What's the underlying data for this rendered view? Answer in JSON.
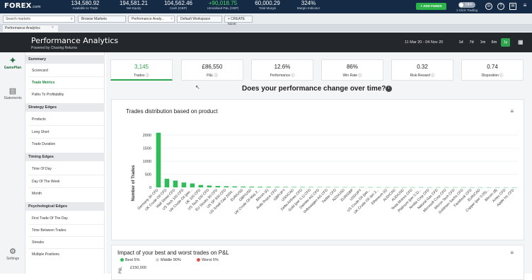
{
  "topbar": {
    "logo": "FOREX",
    "logo_suffix": ".com",
    "metrics": [
      {
        "value": "134,580.92",
        "label": "Available to Trade"
      },
      {
        "value": "194,581.21",
        "label": "Net Equity"
      },
      {
        "value": "104,562.46",
        "label": "Cash (GBP)"
      },
      {
        "value": "+90,018.75",
        "label": "Unrealised P&L (GBP)"
      },
      {
        "value": "60,000.29",
        "label": "Total Margin"
      },
      {
        "value": "324%",
        "label": "Margin Indicator"
      }
    ],
    "add_funds": "+ ADD FUNDS",
    "toggle_label": "OFF",
    "one_click": "1-Click Trading",
    "icons": [
      "phone-icon",
      "help-icon",
      "mail-icon",
      "menu-icon"
    ]
  },
  "tabbar": {
    "search_placeholder": "Search markets",
    "tabs": [
      "Browse Markets",
      "Performance Analy...",
      "Default Workspace",
      "+ CREATE NEW"
    ]
  },
  "subtab": {
    "label": "Performance Analytics"
  },
  "header": {
    "title": "Performance Analytics",
    "subtitle": "Powered by Chasing Returns",
    "date_range": "11 Mar 20  -  04 Nov 20",
    "periods": [
      "1d",
      "7d",
      "1m",
      "6m",
      "1y"
    ],
    "active_period": "1y"
  },
  "rail": {
    "items": [
      {
        "label": "GamePlan",
        "glyph": "✦"
      },
      {
        "label": "Statements",
        "glyph": "▤"
      },
      {
        "label": "Settings",
        "glyph": "⚙"
      }
    ]
  },
  "sidenav": {
    "sections": [
      {
        "title": "Summary",
        "items": [
          "Scorecard",
          "Trade Metrics",
          "Paths To Profitability"
        ]
      },
      {
        "title": "Strategy Edges",
        "items": [
          "Products",
          "Long Short",
          "Trade Duration"
        ]
      },
      {
        "title": "Timing Edges",
        "items": [
          "Time Of Day",
          "Day Of The Week",
          "Month"
        ]
      },
      {
        "title": "Psychological Edges",
        "items": [
          "First Trade Of The Day",
          "Time Between Trades",
          "Streaks",
          "Multiple Positions"
        ]
      }
    ],
    "active_item": "Trade Metrics"
  },
  "cards": [
    {
      "value": "3,145",
      "label": "Trades"
    },
    {
      "value": "£86,550",
      "label": "P&L"
    },
    {
      "value": "12.6%",
      "label": "Performance"
    },
    {
      "value": "86%",
      "label": "Win Rate"
    },
    {
      "value": "0.32",
      "label": "Risk:Reward"
    },
    {
      "value": "0.74",
      "label": "Disposition"
    }
  ],
  "question": "Does your performance change over time?",
  "chart_data": {
    "type": "bar",
    "title": "Trades distribution based on product",
    "ylabel": "Number of Trades",
    "xlabel": "",
    "ylim": [
      0,
      2000
    ],
    "yticks": [
      0,
      500,
      1000,
      1500,
      2000
    ],
    "color": "#2ebd59",
    "categories": [
      "Germany 30 CFD",
      "UK Crude Oil CFD",
      "Wall Street CFD",
      "US Tech 100 CFD",
      "UK Crude Oil (per...",
      "UK 100 CFD",
      "US Tech 100 CFD",
      "EU Stocks 50 CFD",
      "US SP 500 CFD",
      "US Small Cap 2000...",
      "EUR/USD",
      "GBP/USD",
      "UK Crude Oil May 2...",
      "Bitcoin (£)",
      "Rolls Royce CFD",
      "GBP/JPY",
      "USD/CAD",
      "Delta Airlines CFD",
      "Gold (per 0.1) CFD",
      "Daimler AG CFD",
      "Volkswagen AG CFD",
      "Twitter CFD",
      "NZD/USD",
      "EUR/GBP",
      "USD/JPY",
      "US Crude Oil (per...",
      "UK Crude Oil Jan 2...",
      "Ethereum (£)",
      "AUD/CAD",
      "AUD/USD",
      "Tesla Motors CFD",
      "Platinum (per 0.1)...",
      "Nvidia Corp CFD",
      "Natural Gas CFD",
      "Microsoft Corp CFD",
      "Micron Tech CFD",
      "Goldman Sachs CFD",
      "Facebook CFD",
      "EUR/CAD",
      "Copper (per 0.05)...",
      "Bitcoin ($)",
      "Amex CFD",
      "Apple Inc CFD"
    ],
    "values": [
      2090,
      330,
      260,
      185,
      150,
      90,
      70,
      55,
      45,
      38,
      32,
      28,
      25,
      22,
      20,
      18,
      16,
      15,
      14,
      12,
      11,
      10,
      9,
      8,
      8,
      7,
      7,
      6,
      6,
      5,
      5,
      5,
      4,
      4,
      4,
      3,
      3,
      3,
      2,
      2,
      2,
      2,
      1
    ]
  },
  "impact": {
    "title": "Impact of your best and worst trades on P&L",
    "legend": [
      {
        "name": "Best 5%",
        "color": "#2ebd59"
      },
      {
        "name": "Middle 90%",
        "color": "#cfd3d8"
      },
      {
        "name": "Worst 5%",
        "color": "#e0524a"
      }
    ],
    "ytick": "£150,000",
    "ylabel": "P&L"
  }
}
